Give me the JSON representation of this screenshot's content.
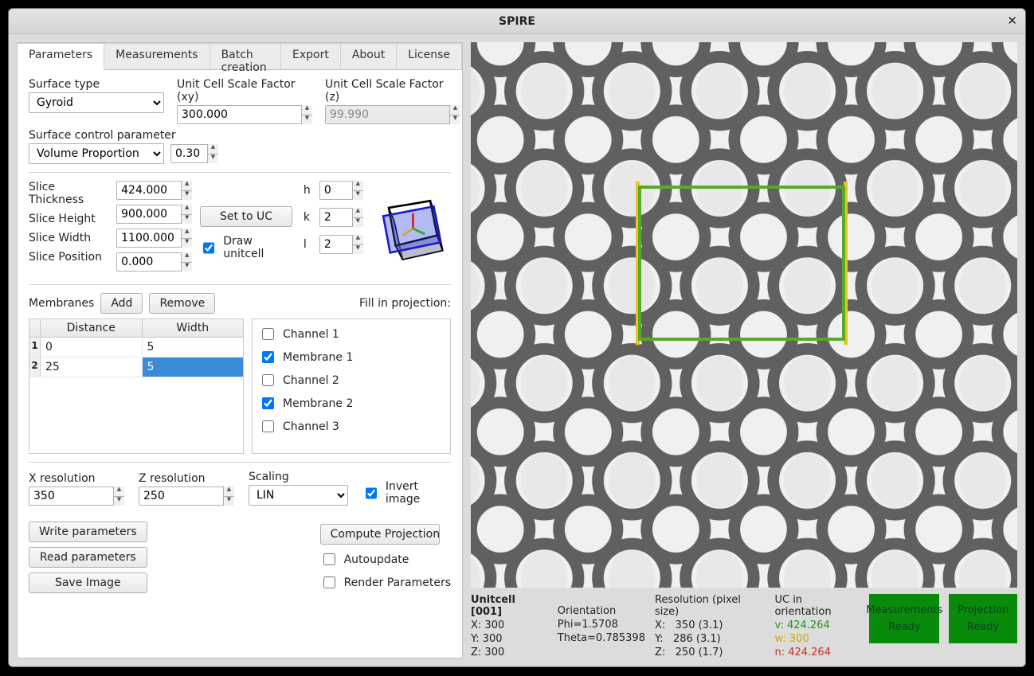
{
  "window": {
    "title": "SPIRE"
  },
  "tabs": [
    "Parameters",
    "Measurements",
    "Batch creation",
    "Export",
    "About",
    "License"
  ],
  "activeTab": 0,
  "surface": {
    "type_label": "Surface type",
    "type_value": "Gyroid",
    "scale_xy_label": "Unit Cell Scale Factor (xy)",
    "scale_xy_value": "300.000",
    "scale_z_label": "Unit Cell Scale Factor  (z)",
    "scale_z_value": "99.990",
    "control_label": "Surface control parameter",
    "control_type": "Volume Proportion",
    "control_value": "0.30"
  },
  "slice": {
    "thickness_label": "Slice Thickness",
    "thickness": "424.000",
    "height_label": "Slice Height",
    "height": "900.000",
    "width_label": "Slice Width",
    "width": "1100.000",
    "position_label": "Slice Position",
    "position": "0.000",
    "set_to_uc": "Set to UC",
    "draw_uc": "Draw unitcell",
    "h_label": "h",
    "h": "0",
    "k_label": "k",
    "k": "2",
    "l_label": "l",
    "l": "2"
  },
  "membranes": {
    "label": "Membranes",
    "add": "Add",
    "remove": "Remove",
    "fill_label": "Fill in projection:",
    "headers": {
      "distance": "Distance",
      "width": "Width"
    },
    "rows": [
      {
        "n": "1",
        "distance": "0",
        "width": "5"
      },
      {
        "n": "2",
        "distance": "25",
        "width": "5"
      }
    ],
    "checks": [
      {
        "label": "Channel 1",
        "checked": false
      },
      {
        "label": "Membrane 1",
        "checked": true
      },
      {
        "label": "Channel 2",
        "checked": false
      },
      {
        "label": "Membrane 2",
        "checked": true
      },
      {
        "label": "Channel 3",
        "checked": false
      }
    ]
  },
  "resolution": {
    "x_label": "X resolution",
    "x": "350",
    "z_label": "Z resolution",
    "z": "250",
    "scaling_label": "Scaling",
    "scaling": "LIN",
    "invert_label": "Invert image",
    "invert": true
  },
  "actions": {
    "write": "Write parameters",
    "read": "Read parameters",
    "save": "Save Image",
    "compute": "Compute Projection",
    "autoupdate": "Autoupdate",
    "render": "Render Parameters"
  },
  "status": {
    "unitcell_title": "Unitcell [001]",
    "uc_x": "X: 300",
    "uc_y": "Y: 300",
    "uc_z": "Z: 300",
    "orientation_title": "Orientation",
    "phi": "Phi=1.5708",
    "theta": "Theta=0.785398",
    "res_title": "Resolution (pixel size)",
    "res_x": "X:   350 (3.1)",
    "res_y": "Y:   286 (3.1)",
    "res_z": "Z:   250 (1.7)",
    "uc_orient_title": "UC in orientation",
    "uc_v": "v: 424.264",
    "uc_w": "w: 300",
    "uc_n": "n: 424.264",
    "badge1_a": "Measurements",
    "badge1_b": "Ready",
    "badge2_a": "Projection",
    "badge2_b": "Ready"
  }
}
